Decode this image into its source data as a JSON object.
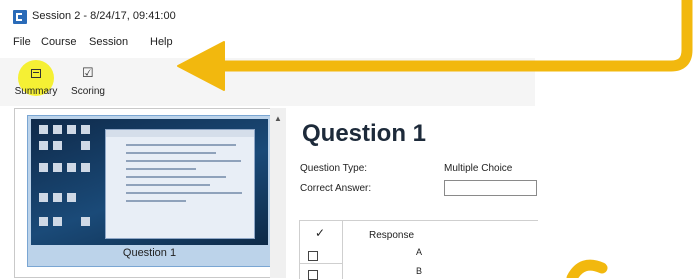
{
  "window": {
    "title": "Session 2 - 8/24/17, 09:41:00"
  },
  "menu": {
    "items": [
      "File",
      "Course",
      "Session",
      "Help"
    ]
  },
  "toolbar": {
    "summary_label": "Summary",
    "scoring_label": "Scoring"
  },
  "thumbnail": {
    "caption": "Question 1"
  },
  "question": {
    "title": "Question 1",
    "type_label": "Question Type:",
    "type_value": "Multiple Choice",
    "answer_label": "Correct Answer:",
    "answer_value": ""
  },
  "responses": {
    "check_header": "✓",
    "header": "Response",
    "rows": [
      {
        "letter": "A"
      },
      {
        "letter": "B"
      }
    ]
  },
  "colors": {
    "accent_yellow": "#f2b80e",
    "highlight_yellow": "#f5f034",
    "app_blue": "#2a6bb8"
  },
  "icons": {
    "app": "app-icon",
    "summary": "summary-icon",
    "scoring": "scoring-icon",
    "annotation": "arrow-annotation"
  }
}
